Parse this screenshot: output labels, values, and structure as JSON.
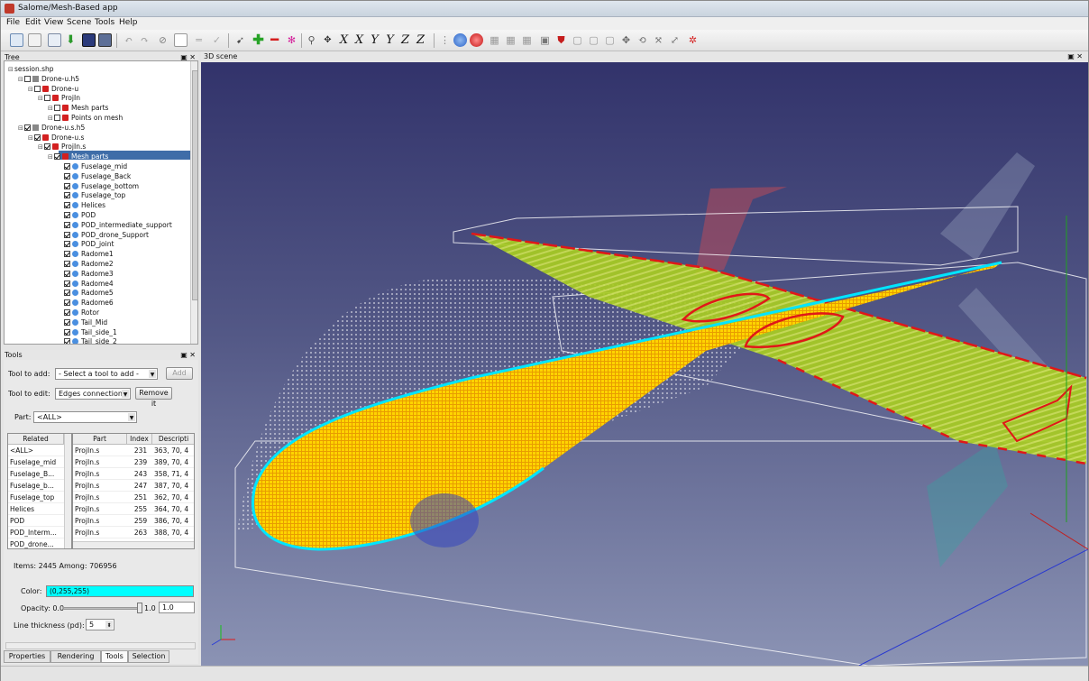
{
  "window": {
    "title": "Salome/Mesh-Based app"
  },
  "menu": [
    "File",
    "Edit",
    "View",
    "Scene",
    "Tools",
    "Help"
  ],
  "toolbar": {
    "axis_buttons": [
      "X",
      "X",
      "Y",
      "Y",
      "Z",
      "Z"
    ]
  },
  "tree_panel": {
    "title": "Tree",
    "items": [
      {
        "label": "session.shp",
        "depth": 0,
        "icon": "none",
        "checked": false,
        "has_box": false
      },
      {
        "label": "Drone-u.h5",
        "depth": 1,
        "icon": "grid",
        "checked": false,
        "has_box": true
      },
      {
        "label": "Drone-u",
        "depth": 2,
        "icon": "red",
        "checked": false,
        "has_box": true
      },
      {
        "label": "ProjIn",
        "depth": 3,
        "icon": "red",
        "checked": false,
        "has_box": true
      },
      {
        "label": "Mesh parts",
        "depth": 4,
        "icon": "red",
        "checked": false,
        "has_box": true
      },
      {
        "label": "Points on mesh",
        "depth": 4,
        "icon": "red",
        "checked": false,
        "has_box": true
      },
      {
        "label": "Drone-u.s.h5",
        "depth": 1,
        "icon": "grid",
        "checked": true,
        "has_box": true
      },
      {
        "label": "Drone-u.s",
        "depth": 2,
        "icon": "red",
        "checked": true,
        "has_box": true
      },
      {
        "label": "ProjIn.s",
        "depth": 3,
        "icon": "red",
        "checked": true,
        "has_box": true
      },
      {
        "label": "Mesh parts",
        "depth": 4,
        "icon": "red",
        "checked": true,
        "has_box": true,
        "selected": true
      },
      {
        "label": "Fuselage_mid",
        "depth": 5,
        "icon": "blue",
        "checked": true,
        "has_box": true
      },
      {
        "label": "Fuselage_Back",
        "depth": 5,
        "icon": "blue",
        "checked": true,
        "has_box": true
      },
      {
        "label": "Fuselage_bottom",
        "depth": 5,
        "icon": "blue",
        "checked": true,
        "has_box": true
      },
      {
        "label": "Fuselage_top",
        "depth": 5,
        "icon": "blue",
        "checked": true,
        "has_box": true
      },
      {
        "label": "Helices",
        "depth": 5,
        "icon": "blue",
        "checked": true,
        "has_box": true
      },
      {
        "label": "POD",
        "depth": 5,
        "icon": "blue",
        "checked": true,
        "has_box": true
      },
      {
        "label": "POD_intermediate_support",
        "depth": 5,
        "icon": "blue",
        "checked": true,
        "has_box": true
      },
      {
        "label": "POD_drone_Support",
        "depth": 5,
        "icon": "blue",
        "checked": true,
        "has_box": true
      },
      {
        "label": "POD_joint",
        "depth": 5,
        "icon": "blue",
        "checked": true,
        "has_box": true
      },
      {
        "label": "Radome1",
        "depth": 5,
        "icon": "blue",
        "checked": true,
        "has_box": true
      },
      {
        "label": "Radome2",
        "depth": 5,
        "icon": "blue",
        "checked": true,
        "has_box": true
      },
      {
        "label": "Radome3",
        "depth": 5,
        "icon": "blue",
        "checked": true,
        "has_box": true
      },
      {
        "label": "Radome4",
        "depth": 5,
        "icon": "blue",
        "checked": true,
        "has_box": true
      },
      {
        "label": "Radome5",
        "depth": 5,
        "icon": "blue",
        "checked": true,
        "has_box": true
      },
      {
        "label": "Radome6",
        "depth": 5,
        "icon": "blue",
        "checked": true,
        "has_box": true
      },
      {
        "label": "Rotor",
        "depth": 5,
        "icon": "blue",
        "checked": true,
        "has_box": true
      },
      {
        "label": "Tail_Mid",
        "depth": 5,
        "icon": "blue",
        "checked": true,
        "has_box": true
      },
      {
        "label": "Tail_side_1",
        "depth": 5,
        "icon": "blue",
        "checked": true,
        "has_box": true
      },
      {
        "label": "Tail_side_2",
        "depth": 5,
        "icon": "blue",
        "checked": true,
        "has_box": true
      }
    ]
  },
  "tools_panel": {
    "title": "Tools",
    "tool_to_add_label": "Tool to add:",
    "tool_to_add_value": "- Select a tool to add -",
    "add_button": "Add",
    "tool_to_edit_label": "Tool to edit:",
    "tool_to_edit_value": "Edges connections",
    "remove_button": "Remove it",
    "part_label": "Part:",
    "part_value": "<ALL>",
    "related_header": "Related",
    "related": [
      "<ALL>",
      "Fuselage_mid",
      "Fuselage_B...",
      "Fuselage_b...",
      "Fuselage_top",
      "Helices",
      "POD",
      "POD_Interm...",
      "POD_drone..."
    ],
    "table_headers": [
      "Part",
      "Index",
      "Descripti"
    ],
    "rows": [
      [
        "ProjIn.s",
        "231",
        "363, 70, 4"
      ],
      [
        "ProjIn.s",
        "239",
        "389, 70, 4"
      ],
      [
        "ProjIn.s",
        "243",
        "358, 71, 4"
      ],
      [
        "ProjIn.s",
        "247",
        "387, 70, 4"
      ],
      [
        "ProjIn.s",
        "251",
        "362, 70, 4"
      ],
      [
        "ProjIn.s",
        "255",
        "364, 70, 4"
      ],
      [
        "ProjIn.s",
        "259",
        "386, 70, 4"
      ],
      [
        "ProjIn.s",
        "263",
        "388, 70, 4"
      ]
    ],
    "items_text": "Items: 2445  Among: 706956",
    "color_label": "Color:",
    "color_value": "(0,255,255)",
    "color_hex": "#00ffff",
    "opacity_label": "Opacity: 0.0",
    "opacity_max": "1.0",
    "opacity_value": "1.0",
    "line_thickness_label": "Line thickness (pd):",
    "line_thickness_value": "5"
  },
  "bottom_tabs": [
    "Properties",
    "Rendering",
    "Tools",
    "Selection"
  ],
  "scene": {
    "title": "3D scene",
    "colors": {
      "wing": "#b8d822",
      "fuselage": "#ffd400",
      "edge": "#00e5ff",
      "highlight": "#e01818"
    }
  }
}
